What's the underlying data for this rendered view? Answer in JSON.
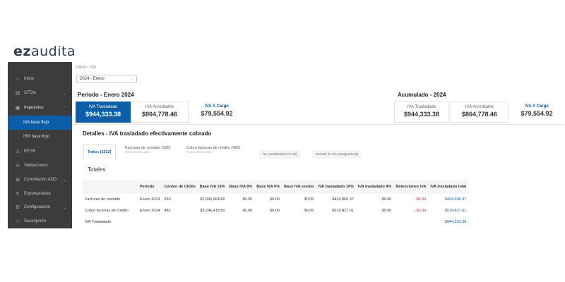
{
  "brand": {
    "logo_ez": "ez",
    "logo_rest": "audita"
  },
  "sidebar": {
    "items": [
      {
        "label": "Inicio",
        "icon": "home-icon",
        "glyph": "⌂"
      },
      {
        "label": "CFDIs",
        "icon": "document-icon",
        "glyph": "▤",
        "chevron": "⌄"
      },
      {
        "label": "Impuestos",
        "icon": "tax-icon",
        "glyph": "▣",
        "chevron": "⌃"
      },
      {
        "label": "IVA base flujo"
      },
      {
        "label": "ISR base flujo"
      },
      {
        "label": "EFOS",
        "icon": "alert-icon",
        "glyph": "⚠"
      },
      {
        "label": "Validaciones",
        "icon": "check-icon",
        "glyph": "⊙"
      },
      {
        "label": "Conciliación ADD",
        "icon": "bank-icon",
        "glyph": "⊞",
        "chevron": "⌄"
      },
      {
        "label": "Exportaciones",
        "icon": "export-icon",
        "glyph": "↯"
      },
      {
        "label": "Configuración",
        "icon": "gear-icon",
        "glyph": "⚙",
        "chevron": "⌄"
      },
      {
        "label": "Suscripción",
        "icon": "star-icon",
        "glyph": "☆"
      }
    ]
  },
  "breadcrumb": "Inicio / IVA",
  "period_select": {
    "value": "2024 - Enero",
    "caret": "⌄"
  },
  "period_section": {
    "title": "Periodo - Enero 2024",
    "cards": [
      {
        "label": "IVA Trasladado",
        "value": "$944,333.38"
      },
      {
        "label": "IVA Acreditable",
        "value": "$864,778.46"
      },
      {
        "label": "IVA A Cargo",
        "value": "$79,554.92"
      }
    ]
  },
  "accum_section": {
    "title": "Acumulado - 2024",
    "cards": [
      {
        "label": "IVA Trasladado",
        "value": "$944,333.38"
      },
      {
        "label": "IVA Acreditable",
        "value": "$864,778.46"
      },
      {
        "label": "IVA A Cargo",
        "value": "$79,554.92"
      }
    ]
  },
  "details": {
    "title": "Detalles - IVA trasladado efectivamente cobrado",
    "tabs": [
      {
        "label": "Todos (1012)"
      },
      {
        "label": "Facturas de contado (530)",
        "sub": "Periodo Enero 2024"
      },
      {
        "label": "Cobro facturas de crédito (482)",
        "sub": "Periodo Enero 2024"
      }
    ],
    "chips": [
      {
        "label": "No considerados IVA (0)"
      },
      {
        "label": "Periodo de IVA reasignado (0)"
      }
    ],
    "totales_label": "Totales",
    "table": {
      "headers": [
        "",
        "Periodo",
        "Conteo de CFDIs",
        "Base IVA 16%",
        "Base IVA 8%",
        "Base IVA 0%",
        "Base IVA exento",
        "IVA trasladado 16%",
        "IVA trasladado 8%",
        "Retenciones IVA",
        "IVA trasladado total"
      ],
      "rows": [
        [
          "Facturas de contado",
          "Enero 2024",
          "530",
          "$2,655,664.82",
          "$0.00",
          "$0.00",
          "$0.00",
          "$424,906.37",
          "$0.00",
          "$0.00",
          "$424,906.37"
        ],
        [
          "Cobro facturas de crédito",
          "Enero 2024",
          "482",
          "$3,246,418.50",
          "$0.00",
          "$0.00",
          "$0.00",
          "$519,427.01",
          "$0.00",
          "-$0.00",
          "$519,427.01"
        ],
        [
          "IVA Trasladado",
          "",
          "",
          "",
          "",
          "",
          "",
          "",
          "",
          "",
          "$944,333.38"
        ]
      ]
    }
  },
  "colors": {
    "accent": "#0b5ea8",
    "sidebar_bg": "#3c3c3c",
    "negative": "#dd2222"
  }
}
